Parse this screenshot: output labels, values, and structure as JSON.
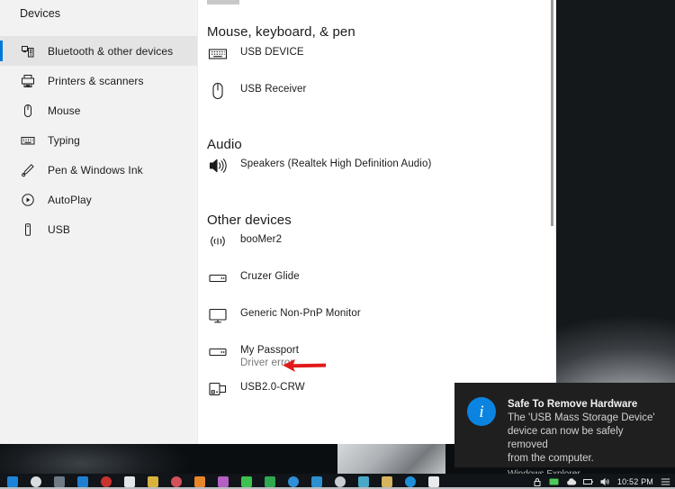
{
  "window": {
    "sidebar": {
      "title": "Devices",
      "items": [
        {
          "label": "Bluetooth & other devices",
          "icon": "bluetooth-devices-icon",
          "selected": true
        },
        {
          "label": "Printers & scanners",
          "icon": "printer-icon",
          "selected": false
        },
        {
          "label": "Mouse",
          "icon": "mouse-icon",
          "selected": false
        },
        {
          "label": "Typing",
          "icon": "keyboard-icon",
          "selected": false
        },
        {
          "label": "Pen & Windows Ink",
          "icon": "pen-icon",
          "selected": false
        },
        {
          "label": "AutoPlay",
          "icon": "autoplay-icon",
          "selected": false
        },
        {
          "label": "USB",
          "icon": "usb-icon",
          "selected": false
        }
      ]
    },
    "content": {
      "sections": [
        {
          "heading": "Mouse, keyboard, & pen",
          "devices": [
            {
              "name": "USB DEVICE",
              "status": "",
              "icon": "keyboard-icon"
            },
            {
              "name": "USB Receiver",
              "status": "",
              "icon": "mouse-icon"
            }
          ]
        },
        {
          "heading": "Audio",
          "devices": [
            {
              "name": "Speakers (Realtek High Definition Audio)",
              "status": "",
              "icon": "speaker-icon"
            }
          ]
        },
        {
          "heading": "Other devices",
          "devices": [
            {
              "name": "booMer2",
              "status": "",
              "icon": "wireless-signal-icon"
            },
            {
              "name": "Cruzer Glide",
              "status": "",
              "icon": "usb-drive-icon"
            },
            {
              "name": "Generic Non-PnP Monitor",
              "status": "",
              "icon": "monitor-icon"
            },
            {
              "name": "My Passport",
              "status": "Driver error",
              "icon": "usb-drive-icon"
            },
            {
              "name": "USB2.0-CRW",
              "status": "",
              "icon": "card-reader-icon"
            }
          ]
        }
      ]
    }
  },
  "annotation": {
    "type": "red-arrow",
    "points_to": "Driver error",
    "color": "#e01b1b"
  },
  "toast": {
    "icon": "info-icon",
    "icon_glyph": "i",
    "title": "Safe To Remove Hardware",
    "message_lines": [
      "The 'USB Mass Storage Device'",
      "device can now be safely removed",
      "from the computer."
    ],
    "app": "Windows Explorer",
    "accent_color": "#0a84e0",
    "background_color": "#1f1f1f"
  },
  "taskbar": {
    "pinned": [
      {
        "name": "start-button",
        "color": "#1b84d8"
      },
      {
        "name": "cortana-search-icon",
        "color": "#d9dde0"
      },
      {
        "name": "task-view-icon",
        "color": "#6f7a85"
      },
      {
        "name": "file-explorer-icon",
        "color": "#1f7fd1"
      },
      {
        "name": "opera-icon",
        "color": "#c9332e"
      },
      {
        "name": "calculator-icon",
        "color": "#e2e5e8"
      },
      {
        "name": "notepad-icon",
        "color": "#d8b23c"
      },
      {
        "name": "firefox-icon",
        "color": "#d4505a"
      },
      {
        "name": "vlc-icon",
        "color": "#e8862a"
      },
      {
        "name": "paint-icon",
        "color": "#b45fc2"
      },
      {
        "name": "notes-icon",
        "color": "#3cc14e"
      },
      {
        "name": "updates-icon",
        "color": "#2fa84f"
      },
      {
        "name": "browser-icon",
        "color": "#2f8fd8"
      },
      {
        "name": "store-icon",
        "color": "#2c8fd0"
      },
      {
        "name": "settings-icon",
        "color": "#c9ccd0"
      },
      {
        "name": "recycle-bin-icon",
        "color": "#4aa8c8"
      },
      {
        "name": "explorer-window-icon",
        "color": "#d4b45c"
      },
      {
        "name": "edge-icon",
        "color": "#1f8fd8"
      },
      {
        "name": "cleaner-icon",
        "color": "#e8eaec"
      }
    ],
    "tray": [
      {
        "name": "lock-icon"
      },
      {
        "name": "monitor-tray-icon"
      },
      {
        "name": "cloud-icon"
      },
      {
        "name": "battery-icon"
      },
      {
        "name": "volume-icon"
      }
    ],
    "clock": "10:52 PM",
    "action_center": "action-center-icon"
  }
}
